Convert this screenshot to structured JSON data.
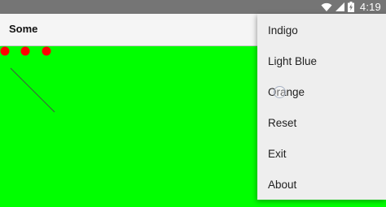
{
  "status_bar": {
    "time": "4:19",
    "icons": [
      "wifi-icon",
      "cell-signal-icon",
      "battery-charging-icon"
    ]
  },
  "app_bar": {
    "title": "Some"
  },
  "canvas": {
    "background": "#00ff00",
    "dot_color": "#ff0000",
    "dot_count": 3
  },
  "menu": {
    "items": [
      {
        "label": "Indigo"
      },
      {
        "label": "Light Blue"
      },
      {
        "label": "Orange"
      },
      {
        "label": "Reset"
      },
      {
        "label": "Exit"
      },
      {
        "label": "About"
      }
    ]
  }
}
